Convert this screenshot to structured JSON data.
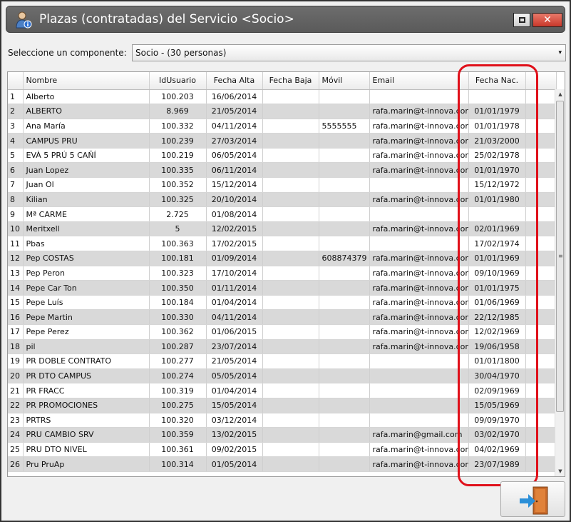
{
  "window": {
    "title": "Plazas (contratadas) del Servicio <Socio>",
    "close_label": "✕"
  },
  "component": {
    "label": "Seleccione un componente:",
    "selected": "Socio - (30 personas)",
    "arrow": "▾"
  },
  "table": {
    "columns": [
      "Nombre",
      "IdUsuario",
      "Fecha Alta",
      "Fecha Baja",
      "Móvil",
      "Email",
      "Fecha Nac."
    ],
    "rows": [
      {
        "n": "1",
        "nombre": "Alberto",
        "id": "100.203",
        "alta": "16/06/2014",
        "baja": "",
        "movil": "",
        "email": "",
        "nac": ""
      },
      {
        "n": "2",
        "nombre": "ALBERTO",
        "id": "8.969",
        "alta": "21/05/2014",
        "baja": "",
        "movil": "",
        "email": "rafa.marin@t-innova.com",
        "nac": "01/01/1979"
      },
      {
        "n": "3",
        "nombre": "Ana María",
        "id": "100.332",
        "alta": "04/11/2014",
        "baja": "",
        "movil": "5555555",
        "email": "rafa.marin@t-innova.com",
        "nac": "01/01/1978"
      },
      {
        "n": "4",
        "nombre": "CAMPUS PRU",
        "id": "100.239",
        "alta": "27/03/2014",
        "baja": "",
        "movil": "",
        "email": "rafa.marin@t-innova.com",
        "nac": "21/03/2000"
      },
      {
        "n": "5",
        "nombre": "EVÀ 5 PRÚ 5 CAÑÍ",
        "id": "100.219",
        "alta": "06/05/2014",
        "baja": "",
        "movil": "",
        "email": "rafa.marin@t-innova.com",
        "nac": "25/02/1978"
      },
      {
        "n": "6",
        "nombre": "Juan Lopez",
        "id": "100.335",
        "alta": "06/11/2014",
        "baja": "",
        "movil": "",
        "email": "rafa.marin@t-innova.com",
        "nac": "01/01/1970"
      },
      {
        "n": "7",
        "nombre": "Juan Ol",
        "id": "100.352",
        "alta": "15/12/2014",
        "baja": "",
        "movil": "",
        "email": "",
        "nac": "15/12/1972"
      },
      {
        "n": "8",
        "nombre": "Kilian",
        "id": "100.325",
        "alta": "20/10/2014",
        "baja": "",
        "movil": "",
        "email": "rafa.marin@t-innova.com",
        "nac": "01/01/1980"
      },
      {
        "n": "9",
        "nombre": "Mª CARME",
        "id": "2.725",
        "alta": "01/08/2014",
        "baja": "",
        "movil": "",
        "email": "",
        "nac": ""
      },
      {
        "n": "10",
        "nombre": "Meritxell",
        "id": "5",
        "alta": "12/02/2015",
        "baja": "",
        "movil": "",
        "email": "rafa.marin@t-innova.com",
        "nac": "02/01/1969"
      },
      {
        "n": "11",
        "nombre": "Pbas",
        "id": "100.363",
        "alta": "17/02/2015",
        "baja": "",
        "movil": "",
        "email": "",
        "nac": "17/02/1974"
      },
      {
        "n": "12",
        "nombre": "Pep  COSTAS",
        "id": "100.181",
        "alta": "01/09/2014",
        "baja": "",
        "movil": "608874379",
        "email": "rafa.marin@t-innova.com",
        "nac": "01/01/1969"
      },
      {
        "n": "13",
        "nombre": "Pep Peron",
        "id": "100.323",
        "alta": "17/10/2014",
        "baja": "",
        "movil": "",
        "email": "rafa.marin@t-innova.com",
        "nac": "09/10/1969"
      },
      {
        "n": "14",
        "nombre": "Pepe Car Ton",
        "id": "100.350",
        "alta": "01/11/2014",
        "baja": "",
        "movil": "",
        "email": "rafa.marin@t-innova.com",
        "nac": "01/01/1975"
      },
      {
        "n": "15",
        "nombre": "Pepe Luís",
        "id": "100.184",
        "alta": "01/04/2014",
        "baja": "",
        "movil": "",
        "email": "rafa.marin@t-innova.com",
        "nac": "01/06/1969"
      },
      {
        "n": "16",
        "nombre": "Pepe Martin",
        "id": "100.330",
        "alta": "04/11/2014",
        "baja": "",
        "movil": "",
        "email": "rafa.marin@t-innova.com",
        "nac": "22/12/1985"
      },
      {
        "n": "17",
        "nombre": "Pepe Perez",
        "id": "100.362",
        "alta": "01/06/2015",
        "baja": "",
        "movil": "",
        "email": "rafa.marin@t-innova.com",
        "nac": "12/02/1969"
      },
      {
        "n": "18",
        "nombre": "pil",
        "id": "100.287",
        "alta": "23/07/2014",
        "baja": "",
        "movil": "",
        "email": "rafa.marin@t-innova.com",
        "nac": "19/06/1958"
      },
      {
        "n": "19",
        "nombre": "PR DOBLE CONTRATO",
        "id": "100.277",
        "alta": "21/05/2014",
        "baja": "",
        "movil": "",
        "email": "",
        "nac": "01/01/1800"
      },
      {
        "n": "20",
        "nombre": "PR DTO CAMPUS",
        "id": "100.274",
        "alta": "05/05/2014",
        "baja": "",
        "movil": "",
        "email": "",
        "nac": "30/04/1970"
      },
      {
        "n": "21",
        "nombre": "PR FRACC",
        "id": "100.319",
        "alta": "01/04/2014",
        "baja": "",
        "movil": "",
        "email": "",
        "nac": "02/09/1969"
      },
      {
        "n": "22",
        "nombre": "PR PROMOCIONES",
        "id": "100.275",
        "alta": "15/05/2014",
        "baja": "",
        "movil": "",
        "email": "",
        "nac": "15/05/1969"
      },
      {
        "n": "23",
        "nombre": "PRTRS",
        "id": "100.320",
        "alta": "03/12/2014",
        "baja": "",
        "movil": "",
        "email": "",
        "nac": "09/09/1970"
      },
      {
        "n": "24",
        "nombre": "PRU CAMBIO SRV",
        "id": "100.359",
        "alta": "13/02/2015",
        "baja": "",
        "movil": "",
        "email": "rafa.marin@gmail.com",
        "nac": "03/02/1970"
      },
      {
        "n": "25",
        "nombre": "PRU DTO NIVEL",
        "id": "100.361",
        "alta": "09/02/2015",
        "baja": "",
        "movil": "",
        "email": "rafa.marin@t-innova.com",
        "nac": "04/02/1969"
      },
      {
        "n": "26",
        "nombre": "Pru PruAp",
        "id": "100.314",
        "alta": "01/05/2014",
        "baja": "",
        "movil": "",
        "email": "rafa.marin@t-innova.com",
        "nac": "23/07/1989"
      }
    ]
  },
  "scrollbar": {
    "up": "▲",
    "down": "▼",
    "grip": "≡"
  }
}
